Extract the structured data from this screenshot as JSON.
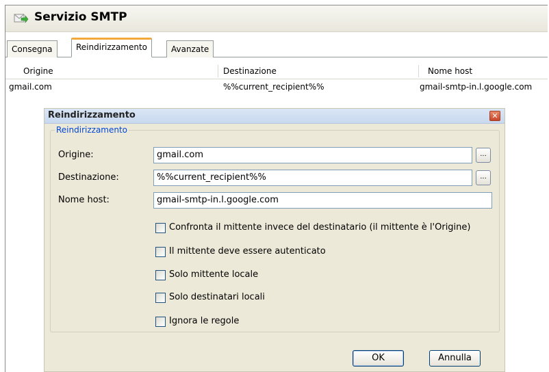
{
  "window": {
    "title": "Servizio SMTP",
    "tabs": [
      "Consegna",
      "Reindirizzamento",
      "Avanzate"
    ]
  },
  "list": {
    "columns": [
      "Origine",
      "Destinazione",
      "Nome host"
    ],
    "rows": [
      [
        "gmail.com",
        "%%current_recipient%%",
        "gmail-smtp-in.l.google.com"
      ]
    ]
  },
  "dialog": {
    "title": "Reindirizzamento",
    "close_glyph": "✕",
    "group_label": "Reindirizzamento",
    "origine_label": "Origine:",
    "origine_value": "gmail.com",
    "destinazione_label": "Destinazione:",
    "destinazione_value": "%%current_recipient%%",
    "nomehost_label": "Nome host:",
    "nomehost_value": "gmail-smtp-in.l.google.com",
    "browse_label": "...",
    "checkboxes": [
      "Confronta il mittente invece del destinatario (il mittente è l'Origine)",
      "Il mittente deve essere autenticato",
      "Solo mittente locale",
      "Solo destinatari locali",
      "Ignora le regole"
    ],
    "ok_label": "OK",
    "cancel_label": "Annulla"
  },
  "colors": {
    "tab_accent": "#f3a83a",
    "group_label": "#0046d5",
    "close_button": "#c9472b"
  },
  "icons": {
    "app": "mail-arrow-icon"
  }
}
